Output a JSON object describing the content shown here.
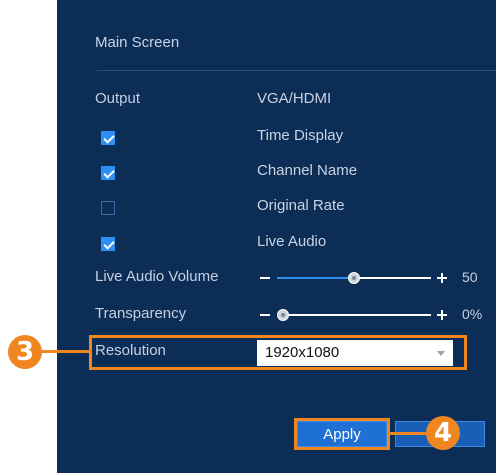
{
  "main_screen": {
    "title": "Main Screen",
    "output_label": "Output",
    "output_value": "VGA/HDMI",
    "options": [
      {
        "label": "Time Display",
        "checked": true
      },
      {
        "label": "Channel Name",
        "checked": true
      },
      {
        "label": "Original Rate",
        "checked": false
      },
      {
        "label": "Live Audio",
        "checked": true
      }
    ],
    "live_audio_volume": {
      "label": "Live Audio Volume",
      "value": 50,
      "display": "50"
    },
    "transparency": {
      "label": "Transparency",
      "value": 0,
      "display": "0%"
    },
    "resolution": {
      "label": "Resolution",
      "value": "1920x1080"
    },
    "apply_label": "Apply"
  },
  "callouts": {
    "step_3": "3",
    "step_4": "4"
  },
  "colors": {
    "panel_bg": "#0c2d55",
    "accent": "#2e8ff2",
    "callout": "#f0861f"
  }
}
